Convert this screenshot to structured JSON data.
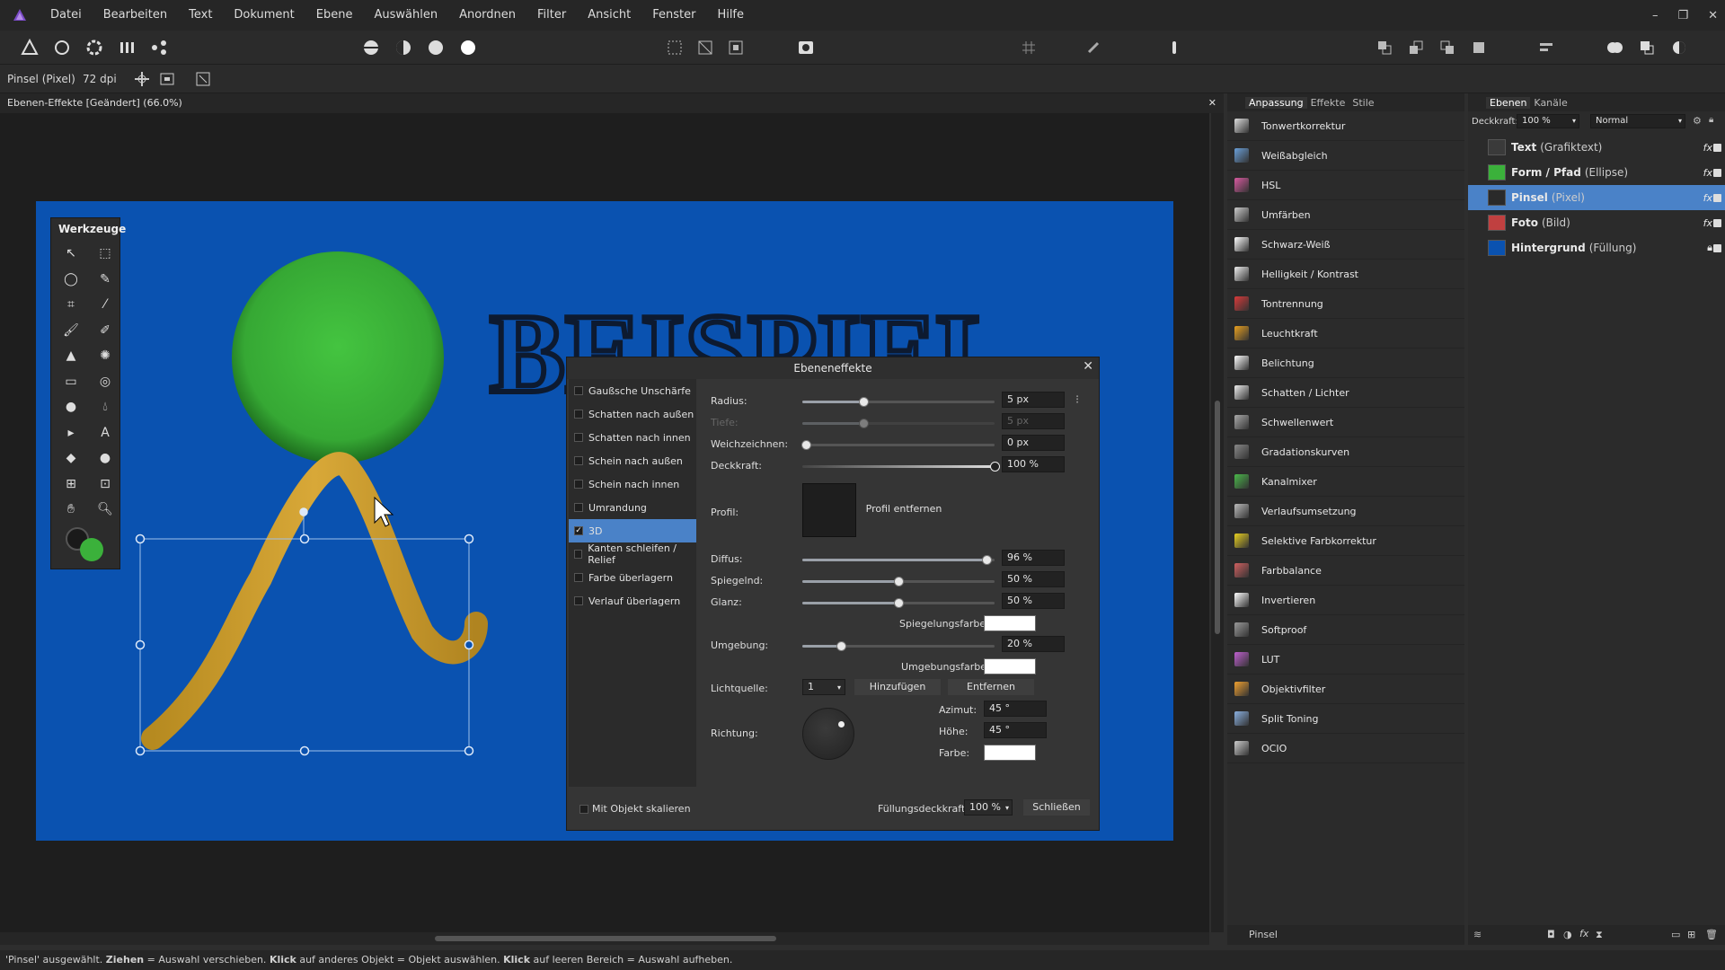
{
  "app": {
    "name": "Affinity Photo",
    "logo_color": "#7b4cc8"
  },
  "menu": [
    "Datei",
    "Bearbeiten",
    "Text",
    "Dokument",
    "Ebene",
    "Auswählen",
    "Anordnen",
    "Filter",
    "Ansicht",
    "Fenster",
    "Hilfe"
  ],
  "window_controls": {
    "minimize": "–",
    "restore": "❐",
    "close": "✕"
  },
  "context_bar": {
    "tool": "Pinsel (Pixel)",
    "dpi": "72 dpi"
  },
  "document_tab": {
    "title": "Ebenen-Effekte [Geändert] (66.0%)",
    "close": "✕"
  },
  "tools_panel": {
    "title": "Werkzeuge",
    "fg_color": "#1a1a1a",
    "bg_color": "#3bb13b"
  },
  "canvas": {
    "background": "#0a52b0",
    "text_art": "BEISPIEL",
    "circle_color": "#3bb13b",
    "brush_color": "#c8a030"
  },
  "dialog": {
    "title": "Ebeneneffekte",
    "effects": [
      {
        "label": "Gaußsche Unschärfe",
        "checked": false,
        "selected": false
      },
      {
        "label": "Schatten nach außen",
        "checked": false,
        "selected": false
      },
      {
        "label": "Schatten nach innen",
        "checked": false,
        "selected": false
      },
      {
        "label": "Schein nach außen",
        "checked": false,
        "selected": false
      },
      {
        "label": "Schein nach innen",
        "checked": false,
        "selected": false
      },
      {
        "label": "Umrandung",
        "checked": false,
        "selected": false
      },
      {
        "label": "3D",
        "checked": true,
        "selected": true
      },
      {
        "label": "Kanten schleifen / Relief",
        "checked": false,
        "selected": false
      },
      {
        "label": "Farbe überlagern",
        "checked": false,
        "selected": false
      },
      {
        "label": "Verlauf überlagern",
        "checked": false,
        "selected": false
      }
    ],
    "radius": {
      "label": "Radius:",
      "value": "5 px",
      "fraction": 0.32
    },
    "tiefe": {
      "label": "Tiefe:",
      "value": "5 px",
      "fraction": 0.32
    },
    "weichzeichnen": {
      "label": "Weichzeichnen:",
      "value": "0 px",
      "fraction": 0.02
    },
    "deckkraft": {
      "label": "Deckkraft:",
      "value": "100 %",
      "fraction": 1.0
    },
    "profil": {
      "label": "Profil:",
      "remove_button": "Profil entfernen"
    },
    "diffus": {
      "label": "Diffus:",
      "value": "96 %",
      "fraction": 0.96
    },
    "spiegelnd": {
      "label": "Spiegelnd:",
      "value": "50 %",
      "fraction": 0.5
    },
    "glanz": {
      "label": "Glanz:",
      "value": "50 %",
      "fraction": 0.5
    },
    "spiegelungsfarbe": {
      "label": "Spiegelungsfarbe:",
      "color": "#ffffff"
    },
    "umgebung": {
      "label": "Umgebung:",
      "value": "20 %",
      "fraction": 0.2
    },
    "umgebungsfarbe": {
      "label": "Umgebungsfarbe:",
      "color": "#ffffff"
    },
    "lichtquelle": {
      "label": "Lichtquelle:",
      "value": "1",
      "add_button": "Hinzufügen",
      "remove_button": "Entfernen"
    },
    "richtung": {
      "label": "Richtung:"
    },
    "azimut": {
      "label": "Azimut:",
      "value": "45 °"
    },
    "hoehe": {
      "label": "Höhe:",
      "value": "45 °"
    },
    "farbe": {
      "label": "Farbe:",
      "color": "#ffffff"
    },
    "mit_objekt_skalieren": {
      "label": "Mit Objekt skalieren",
      "checked": false
    },
    "fuellungsdeckkraft": {
      "label": "Füllungsdeckkraft:",
      "value": "100 %"
    },
    "close_button": "Schließen"
  },
  "adjust_panel": {
    "tabs": [
      "Anpassung",
      "Effekte",
      "Stile"
    ],
    "items": [
      {
        "label": "Tonwertkorrektur",
        "icon": "levels-icon",
        "color": "#dddddd"
      },
      {
        "label": "Weißabgleich",
        "icon": "white-balance-icon",
        "color": "#6a9fd8"
      },
      {
        "label": "HSL",
        "icon": "hsl-icon",
        "color": "#d85aa0"
      },
      {
        "label": "Umfärben",
        "icon": "recolor-icon",
        "color": "#cccccc"
      },
      {
        "label": "Schwarz-Weiß",
        "icon": "black-white-icon",
        "color": "#ffffff"
      },
      {
        "label": "Helligkeit / Kontrast",
        "icon": "brightness-contrast-icon",
        "color": "#eeeeee"
      },
      {
        "label": "Tontrennung",
        "icon": "posterize-icon",
        "color": "#d83a3a"
      },
      {
        "label": "Leuchtkraft",
        "icon": "vibrance-icon",
        "color": "#e8a020"
      },
      {
        "label": "Belichtung",
        "icon": "exposure-icon",
        "color": "#ffffff"
      },
      {
        "label": "Schatten / Lichter",
        "icon": "shadows-highlights-icon",
        "color": "#eeeeee"
      },
      {
        "label": "Schwellenwert",
        "icon": "threshold-icon",
        "color": "#aaaaaa"
      },
      {
        "label": "Gradationskurven",
        "icon": "curves-icon",
        "color": "#888888"
      },
      {
        "label": "Kanalmixer",
        "icon": "channel-mixer-icon",
        "color": "#4ab84a"
      },
      {
        "label": "Verlaufsumsetzung",
        "icon": "gradient-map-icon",
        "color": "#bbbbbb"
      },
      {
        "label": "Selektive Farbkorrektur",
        "icon": "selective-color-icon",
        "color": "#e8d020"
      },
      {
        "label": "Farbbalance",
        "icon": "color-balance-icon",
        "color": "#d06060"
      },
      {
        "label": "Invertieren",
        "icon": "invert-icon",
        "color": "#ffffff"
      },
      {
        "label": "Softproof",
        "icon": "softproof-icon",
        "color": "#999999"
      },
      {
        "label": "LUT",
        "icon": "lut-icon",
        "color": "#c060d0"
      },
      {
        "label": "Objektivfilter",
        "icon": "lens-filter-icon",
        "color": "#f0a030"
      },
      {
        "label": "Split Toning",
        "icon": "split-toning-icon",
        "color": "#8ab0e0"
      },
      {
        "label": "OCIO",
        "icon": "ocio-icon",
        "color": "#cccccc"
      }
    ],
    "footer": "Pinsel"
  },
  "layers_panel": {
    "tabs": [
      "Ebenen",
      "Kanäle"
    ],
    "opacity_label": "Deckkraft:",
    "opacity_value": "100 %",
    "blend_mode": "Normal",
    "layers": [
      {
        "name": "Text",
        "type": "(Grafiktext)",
        "fx": "fx",
        "selected": false,
        "thumb": "#3a3a3a"
      },
      {
        "name": "Form / Pfad",
        "type": "(Ellipse)",
        "fx": "fx",
        "selected": false,
        "thumb": "#3bb13b"
      },
      {
        "name": "Pinsel",
        "type": "(Pixel)",
        "fx": "fx",
        "selected": true,
        "thumb": "#2a2a2a"
      },
      {
        "name": "Foto",
        "type": "(Bild)",
        "fx": "fx",
        "selected": false,
        "thumb": "#c04040"
      },
      {
        "name": "Hintergrund",
        "type": "(Füllung)",
        "fx": "",
        "selected": false,
        "thumb": "#0a52b0"
      }
    ]
  },
  "status": {
    "s1": "'Pinsel' ausgewählt. ",
    "b1": "Ziehen",
    "s2": " = Auswahl verschieben. ",
    "b2": "Klick",
    "s3": " auf anderes Objekt = Objekt auswählen. ",
    "b3": "Klick",
    "s4": " auf leeren Bereich = Auswahl aufheben."
  }
}
